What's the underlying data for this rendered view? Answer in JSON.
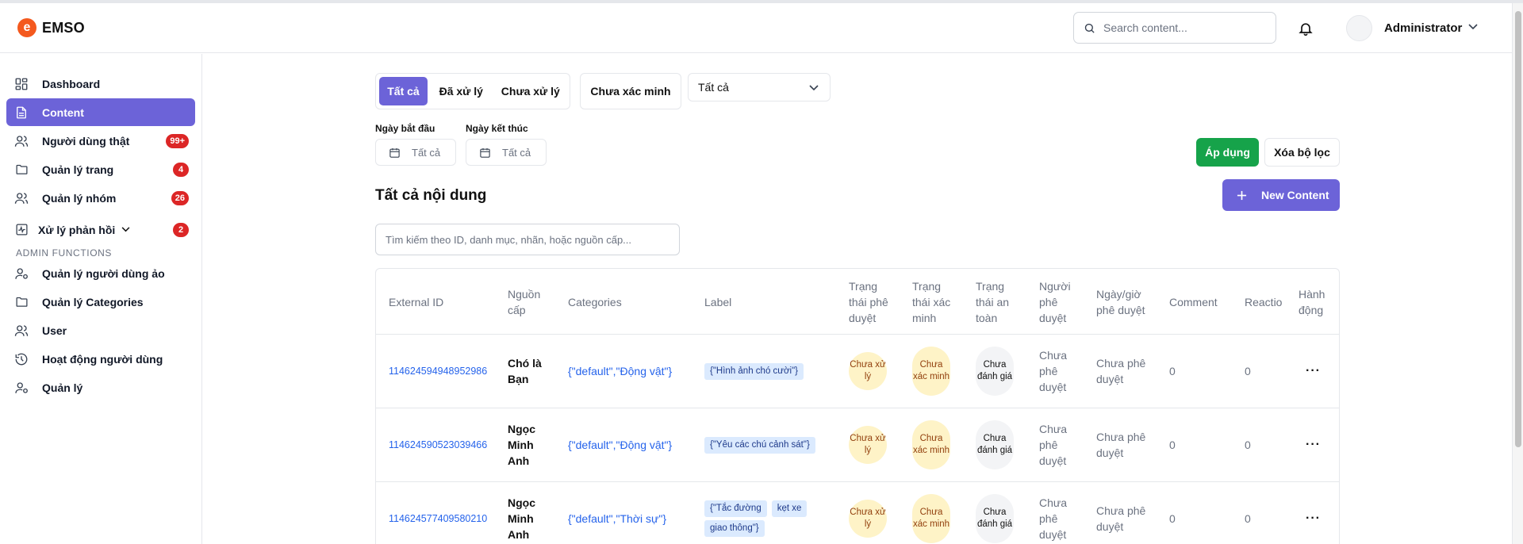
{
  "app": {
    "logo_text": "EMSO",
    "logo_letter": "e"
  },
  "header": {
    "search_placeholder": "Search content...",
    "user_name": "Administrator"
  },
  "sidebar": {
    "items": [
      {
        "label": "Dashboard",
        "icon": "dashboard-icon"
      },
      {
        "label": "Content",
        "icon": "document-icon",
        "active": true
      },
      {
        "label": "Người dùng thật",
        "icon": "users-icon",
        "badge": "99+"
      },
      {
        "label": "Quản lý trang",
        "icon": "folder-icon",
        "badge": "4"
      },
      {
        "label": "Quản lý nhóm",
        "icon": "users-icon",
        "badge": "26"
      },
      {
        "label": "Xử lý phản hồi",
        "icon": "activity-icon",
        "badge": "2"
      }
    ],
    "section_label": "ADMIN FUNCTIONS",
    "admin_items": [
      {
        "label": "Quản lý người dùng ảo",
        "icon": "user-cog-icon"
      },
      {
        "label": "Quản lý Categories",
        "icon": "folder-icon"
      },
      {
        "label": "User",
        "icon": "users-icon"
      },
      {
        "label": "Hoạt động người dùng",
        "icon": "history-icon"
      },
      {
        "label": "Quản lý",
        "icon": "user-cog-icon"
      }
    ]
  },
  "filters": {
    "tabs": [
      "Tất cả",
      "Đã xử lý",
      "Chưa xử lý"
    ],
    "active_tab": "Tất cả",
    "verify_button": "Chưa xác minh",
    "select_value": "Tất cả",
    "start_date_label": "Ngày bắt đầu",
    "end_date_label": "Ngày kết thúc",
    "start_date_value": "Tất cả",
    "end_date_value": "Tất cả",
    "apply_button": "Áp dụng",
    "clear_button": "Xóa bộ lọc"
  },
  "content": {
    "title": "Tất cả nội dung",
    "new_button": "New Content",
    "search_placeholder": "Tìm kiếm theo ID, danh mục, nhãn, hoặc nguồn cấp..."
  },
  "table": {
    "headers": {
      "external_id": "External ID",
      "source": "Nguồn cấp",
      "categories": "Categories",
      "label": "Label",
      "approval_status": "Trạng thái phê duyệt",
      "verification_status": "Trạng thái xác minh",
      "safety_status": "Trạng thái an toàn",
      "approver": "Người phê duyệt",
      "approval_time": "Ngày/giờ phê duyệt",
      "comment": "Comment",
      "reaction": "Reactio",
      "action": "Hành động"
    },
    "rows": [
      {
        "external_id": "114624594948952986",
        "source": "Chó là Bạn",
        "categories": "{\"default\",\"Động vật\"}",
        "labels": [
          "{\"Hình ảnh chó cười\"}"
        ],
        "approval_status": "Chưa xử lý",
        "verification_status": "Chưa xác minh",
        "safety_status": "Chưa đánh giá",
        "approver": "Chưa phê duyệt",
        "approval_time": "Chưa phê duyệt",
        "comment": "0",
        "reaction": "0",
        "action": "···"
      },
      {
        "external_id": "114624590523039466",
        "source": "Ngọc Minh Anh",
        "categories": "{\"default\",\"Động vật\"}",
        "labels": [
          "{\"Yêu các chú cảnh sát\"}"
        ],
        "approval_status": "Chưa xử lý",
        "verification_status": "Chưa xác minh",
        "safety_status": "Chưa đánh giá",
        "approver": "Chưa phê duyệt",
        "approval_time": "Chưa phê duyệt",
        "comment": "0",
        "reaction": "0",
        "action": "···"
      },
      {
        "external_id": "114624577409580210",
        "source": "Ngọc Minh Anh",
        "categories": "{\"default\",\"Thời sự\"}",
        "labels": [
          "{\"Tắc đường",
          "kẹt xe",
          "giao thông\"}"
        ],
        "approval_status": "Chưa xử lý",
        "verification_status": "Chưa xác minh",
        "safety_status": "Chưa đánh giá",
        "approver": "Chưa phê duyệt",
        "approval_time": "Chưa phê duyệt",
        "comment": "0",
        "reaction": "0",
        "action": "···"
      }
    ]
  }
}
